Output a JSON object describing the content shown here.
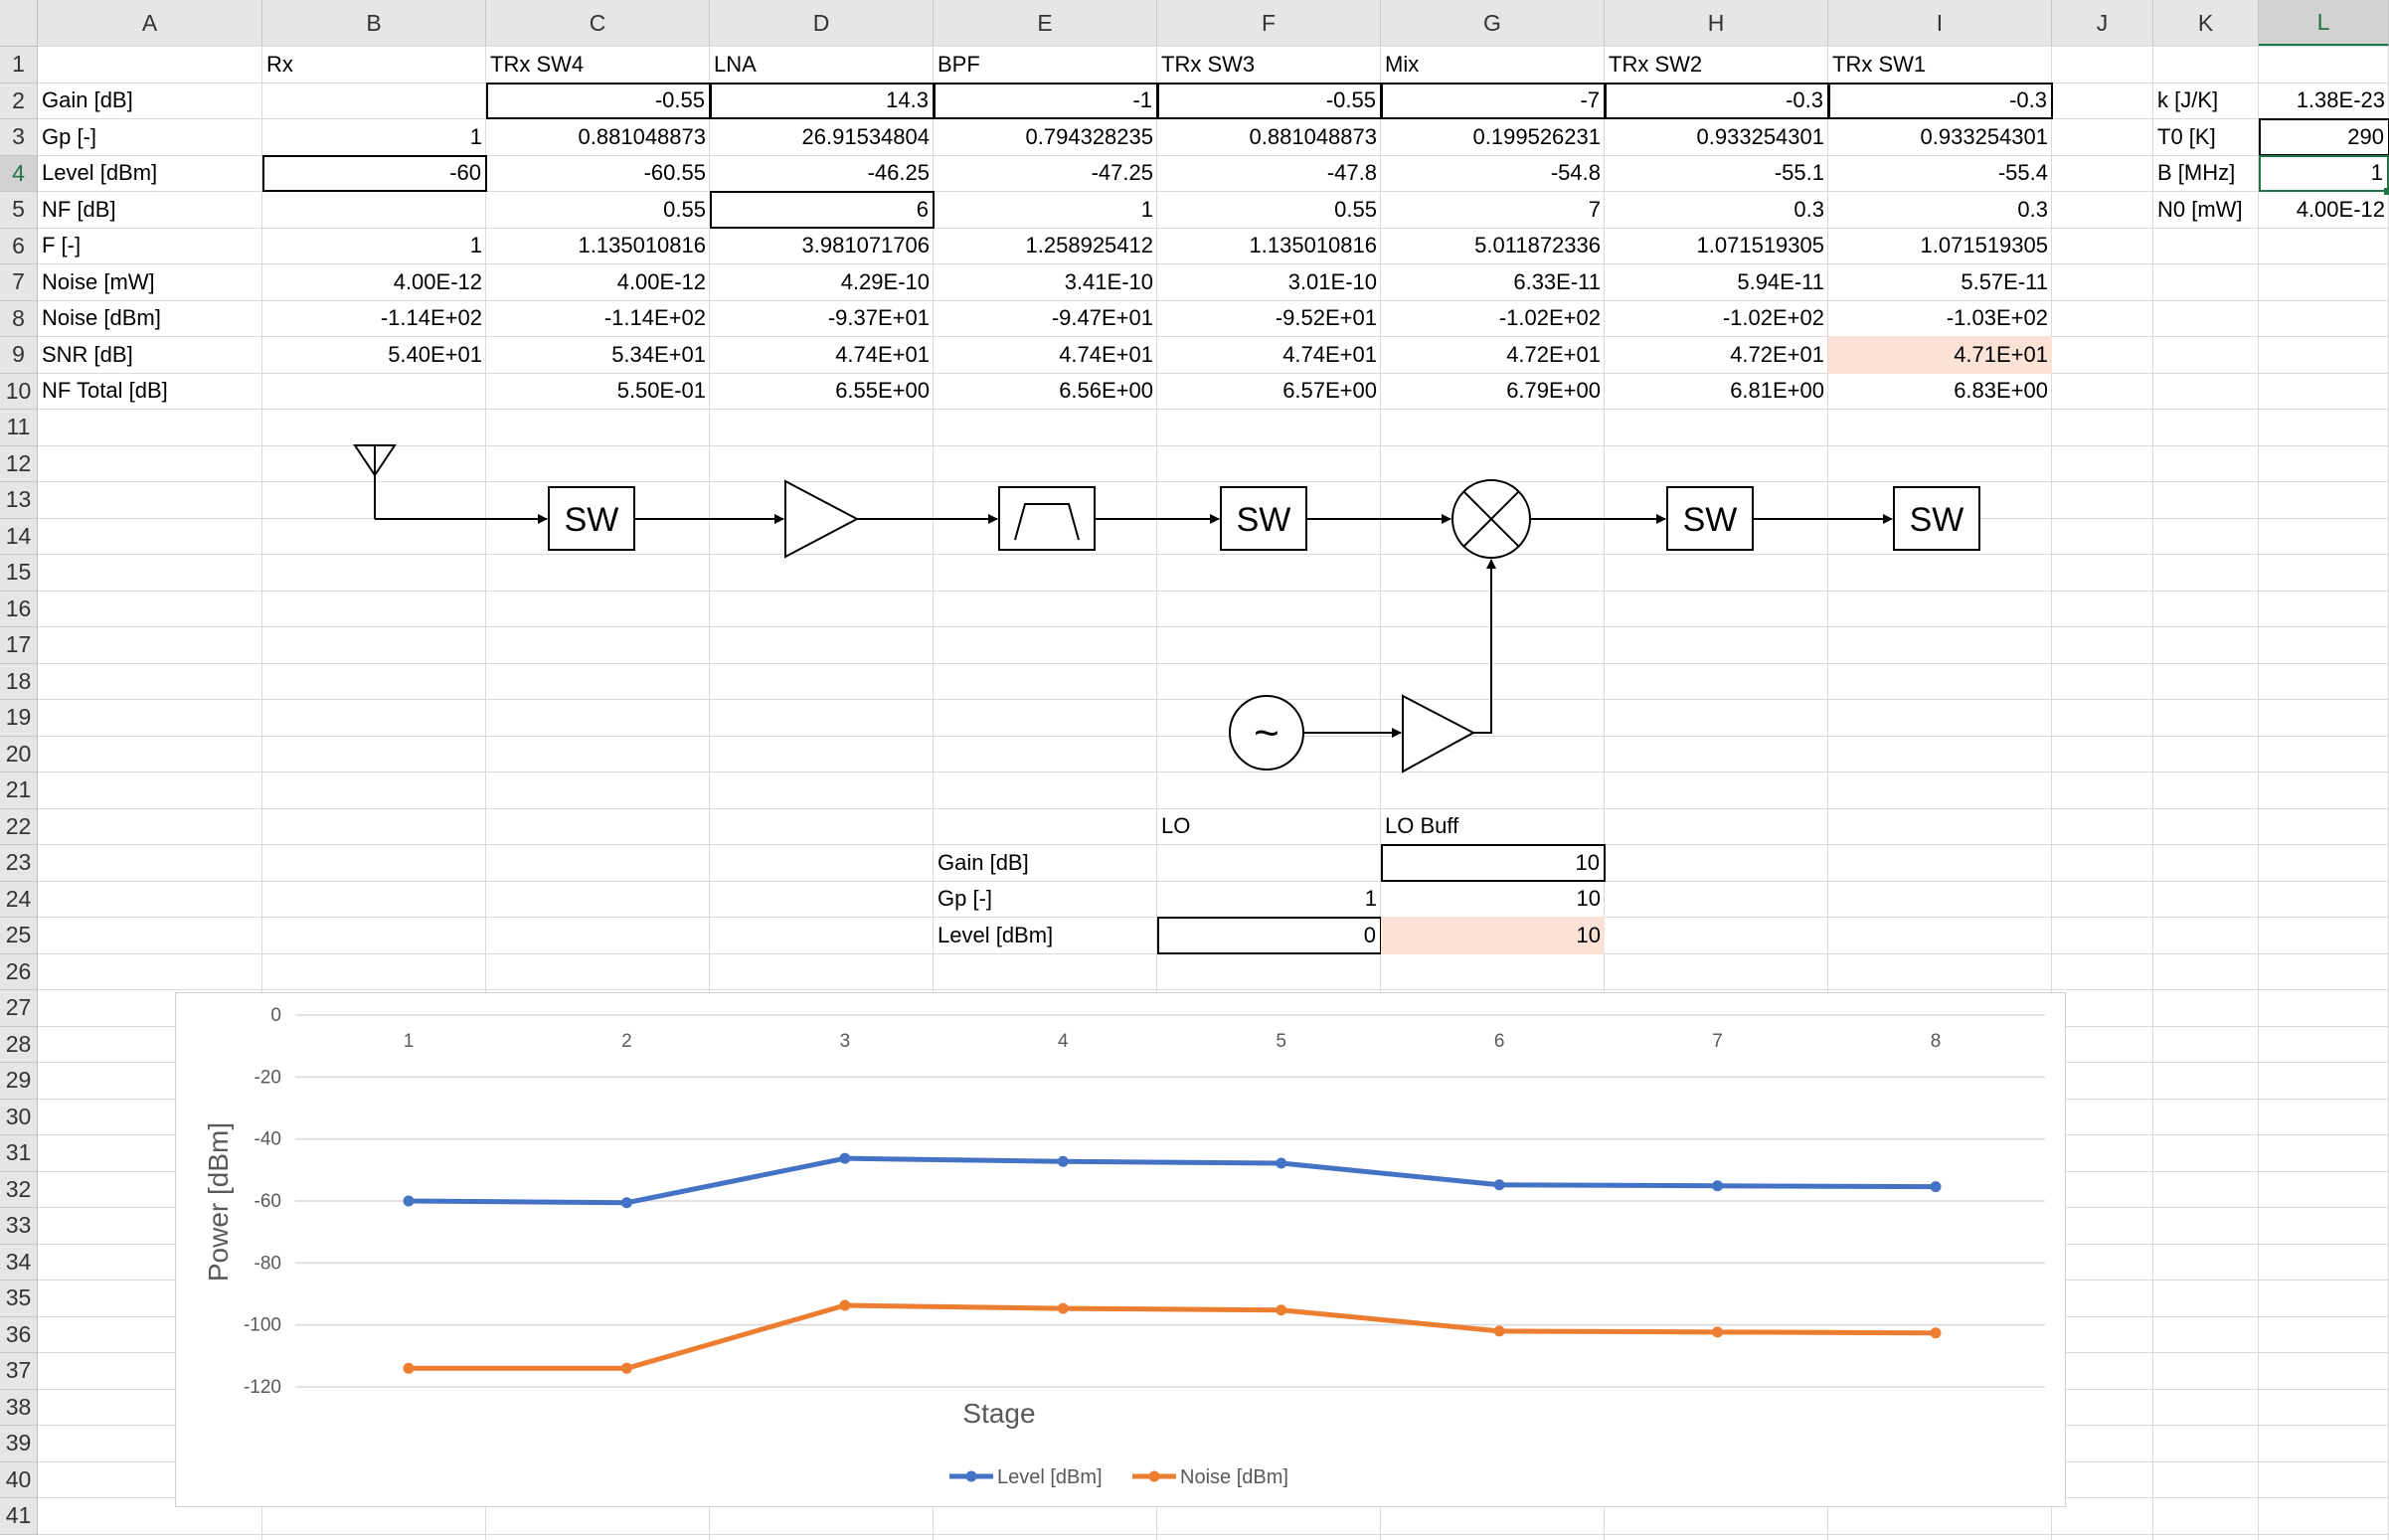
{
  "columns": [
    "A",
    "B",
    "C",
    "D",
    "E",
    "F",
    "G",
    "H",
    "I",
    "J",
    "K",
    "L"
  ],
  "active_column": "L",
  "rows": [
    "1",
    "2",
    "3",
    "4",
    "5",
    "6",
    "7",
    "8",
    "9",
    "10",
    "11",
    "12",
    "13",
    "14",
    "15",
    "16",
    "17",
    "18",
    "19",
    "20",
    "21",
    "22",
    "23",
    "24",
    "25",
    "26",
    "27",
    "28",
    "29",
    "30",
    "31",
    "32",
    "33",
    "34",
    "35",
    "36",
    "37",
    "38",
    "39",
    "40",
    "41"
  ],
  "active_row": "4",
  "table": {
    "stage_names": [
      "Rx",
      "TRx SW4",
      "LNA",
      "BPF",
      "TRx SW3",
      "Mix",
      "TRx SW2",
      "TRx SW1"
    ],
    "row_labels": [
      "Gain [dB]",
      "Gp [-]",
      "Level [dBm]",
      "NF [dB]",
      "F [-]",
      "Noise [mW]",
      "Noise [dBm]",
      "SNR [dB]",
      "NF Total [dB]"
    ],
    "rows": [
      [
        "",
        "-0.55",
        "14.3",
        "-1",
        "-0.55",
        "-7",
        "-0.3",
        "-0.3"
      ],
      [
        "1",
        "0.881048873",
        "26.91534804",
        "0.794328235",
        "0.881048873",
        "0.199526231",
        "0.933254301",
        "0.933254301"
      ],
      [
        "-60",
        "-60.55",
        "-46.25",
        "-47.25",
        "-47.8",
        "-54.8",
        "-55.1",
        "-55.4"
      ],
      [
        "",
        "0.55",
        "6",
        "1",
        "0.55",
        "7",
        "0.3",
        "0.3"
      ],
      [
        "1",
        "1.135010816",
        "3.981071706",
        "1.258925412",
        "1.135010816",
        "5.011872336",
        "1.071519305",
        "1.071519305"
      ],
      [
        "4.00E-12",
        "4.00E-12",
        "4.29E-10",
        "3.41E-10",
        "3.01E-10",
        "6.33E-11",
        "5.94E-11",
        "5.57E-11"
      ],
      [
        "-1.14E+02",
        "-1.14E+02",
        "-9.37E+01",
        "-9.47E+01",
        "-9.52E+01",
        "-1.02E+02",
        "-1.02E+02",
        "-1.03E+02"
      ],
      [
        "5.40E+01",
        "5.34E+01",
        "4.74E+01",
        "4.74E+01",
        "4.74E+01",
        "4.72E+01",
        "4.72E+01",
        "4.71E+01"
      ],
      [
        "",
        "5.50E-01",
        "6.55E+00",
        "6.56E+00",
        "6.57E+00",
        "6.79E+00",
        "6.81E+00",
        "6.83E+00"
      ]
    ]
  },
  "constants": [
    {
      "label": "k [J/K]",
      "value": "1.38E-23"
    },
    {
      "label": "T0 [K]",
      "value": "290"
    },
    {
      "label": "B [MHz]",
      "value": "1"
    },
    {
      "label": "N0 [mW]",
      "value": "4.00E-12"
    }
  ],
  "lo_table": {
    "headers": [
      "LO",
      "LO Buff"
    ],
    "row_labels": [
      "Gain [dB]",
      "Gp [-]",
      "Level [dBm]"
    ],
    "rows": [
      [
        "",
        "10"
      ],
      [
        "1",
        "10"
      ],
      [
        "0",
        "10"
      ]
    ]
  },
  "diagram": {
    "sw_label": "SW",
    "lo_symbol": "~"
  },
  "chart_data": {
    "type": "line",
    "categories": [
      "1",
      "2",
      "3",
      "4",
      "5",
      "6",
      "7",
      "8"
    ],
    "series": [
      {
        "name": "Level [dBm]",
        "color": "#4472c4",
        "values": [
          -60,
          -60.55,
          -46.25,
          -47.25,
          -47.8,
          -54.8,
          -55.1,
          -55.4
        ]
      },
      {
        "name": "Noise [dBm]",
        "color": "#ed7d31",
        "values": [
          -114,
          -114,
          -93.7,
          -94.7,
          -95.2,
          -102,
          -102.3,
          -102.6
        ]
      }
    ],
    "xlabel": "Stage",
    "ylabel": "Power [dBm]",
    "ylim": [
      -120,
      0
    ],
    "yticks": [
      "0",
      "-20",
      "-40",
      "-60",
      "-80",
      "-100",
      "-120"
    ],
    "grid": true,
    "legend": "bottom"
  }
}
